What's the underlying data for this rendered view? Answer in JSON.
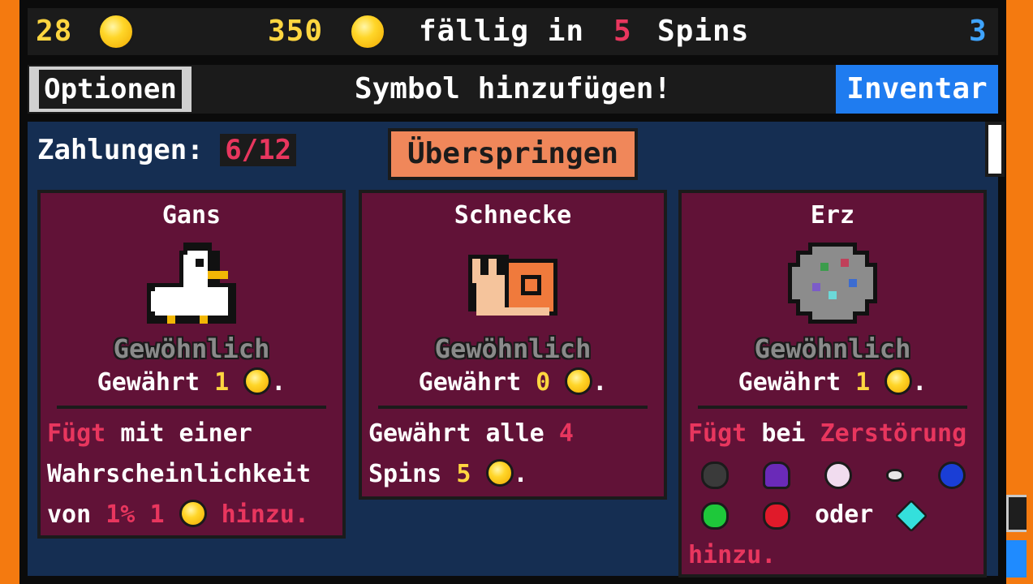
{
  "topbar": {
    "coins": "28",
    "rent_amount": "350",
    "due_text": "fällig in",
    "spins_count": "5",
    "spins_label": "Spins",
    "right_counter": "3"
  },
  "subbar": {
    "options_label": "Optionen",
    "title": "Symbol hinzufügen!",
    "inventory_label": "Inventar"
  },
  "panel": {
    "payments_label": "Zahlungen:",
    "payments_value": "6/12",
    "skip_label": "Überspringen"
  },
  "cards": [
    {
      "name": "Gans",
      "icon": "goose-icon",
      "rarity": "Gewöhnlich",
      "grant_prefix": "Gewährt",
      "grant_value": "1",
      "desc": {
        "add_kw": "Fügt",
        "line1_rest": "mit einer",
        "line2": "Wahrscheinlichkeit",
        "line3_pre": "von",
        "percent": "1%",
        "amount": "1",
        "end_kw": "hinzu."
      }
    },
    {
      "name": "Schnecke",
      "icon": "snail-icon",
      "rarity": "Gewöhnlich",
      "grant_prefix": "Gewährt",
      "grant_value": "0",
      "desc": {
        "line1_pre": "Gewährt alle",
        "every": "4",
        "line2_pre": "Spins",
        "amount": "5"
      }
    },
    {
      "name": "Erz",
      "icon": "ore-icon",
      "rarity": "Gewöhnlich",
      "grant_prefix": "Gewährt",
      "grant_value": "1",
      "desc": {
        "add_kw": "Fügt",
        "mid": "bei",
        "destroy_kw": "Zerstörung",
        "or": "oder",
        "end_kw": "hinzu."
      },
      "gems": [
        "coal-gem-icon",
        "amethyst-gem-icon",
        "pearl-gem-icon",
        "stone-gem-icon",
        "sapphire-gem-icon",
        "emerald-gem-icon",
        "ruby-gem-icon",
        "diamond-gem-icon"
      ]
    }
  ],
  "colors": {
    "background": "#f47a10",
    "panel": "#152e52",
    "card": "#611237",
    "highlight_red": "#e8365e",
    "highlight_yellow": "#ffd640",
    "inventory_button": "#1f7cf0",
    "skip_button": "#f0875a"
  }
}
